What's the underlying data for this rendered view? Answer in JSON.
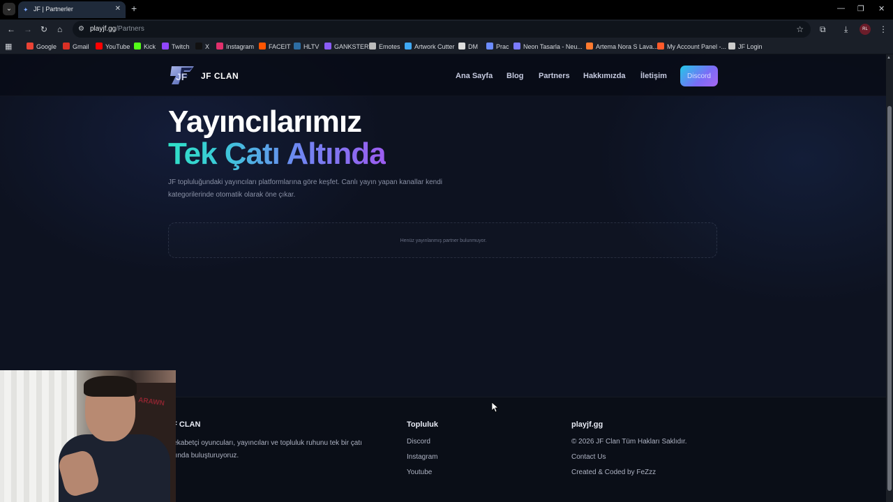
{
  "browser": {
    "tab_title": "JF | Partnerler",
    "url_host": "playjf.gg",
    "url_path": "/Partners",
    "profile_initials": "RL",
    "bookmarks": [
      {
        "label": "Google",
        "icon_color": "#ea4335"
      },
      {
        "label": "Gmail",
        "icon_color": "#d93025"
      },
      {
        "label": "YouTube",
        "icon_color": "#ff0000"
      },
      {
        "label": "Kick",
        "icon_color": "#53fc18"
      },
      {
        "label": "Twitch",
        "icon_color": "#9146ff"
      },
      {
        "label": "X",
        "icon_color": "#111111"
      },
      {
        "label": "Instagram",
        "icon_color": "#e1306c"
      },
      {
        "label": "FACEIT",
        "icon_color": "#ff5500"
      },
      {
        "label": "HLTV",
        "icon_color": "#2d6da3"
      },
      {
        "label": "GANKSTER",
        "icon_color": "#8a5cf6"
      },
      {
        "label": "Emotes",
        "icon_color": "#bbbbbb"
      },
      {
        "label": "Artwork Cutter",
        "icon_color": "#3fa9f5"
      },
      {
        "label": "DM",
        "icon_color": "#dddddd"
      },
      {
        "label": "Prac",
        "icon_color": "#6c8cff"
      },
      {
        "label": "Neon Tasarla - Neu...",
        "icon_color": "#7b7bff"
      },
      {
        "label": "Artema Nora S Lava...",
        "icon_color": "#ff7a2f"
      },
      {
        "label": "My Account Panel -...",
        "icon_color": "#ff5a2a"
      },
      {
        "label": "JF Login",
        "icon_color": "#cccccc"
      }
    ]
  },
  "nav": {
    "brand": "JF CLAN",
    "links": [
      "Ana Sayfa",
      "Blog",
      "Partners",
      "Hakkımızda",
      "İletişim"
    ],
    "cta": "Discord"
  },
  "hero": {
    "line1": "Yayıncılarımız",
    "line2": "Tek Çatı Altında",
    "description": "JF topluluğundaki yayıncıları platformlarına göre keşfet. Canlı yayın yapan kanallar kendi kategorilerinde otomatik olarak öne çıkar."
  },
  "partners": {
    "empty_message": "Henüz yayınlanmış partner bulunmuyor."
  },
  "footer": {
    "brand_title": "JF CLAN",
    "brand_line1": "Rekabetçi oyuncuları, yayıncıları ve topluluk ruhunu tek bir çatı",
    "brand_line2": "altında buluşturuyoruz.",
    "community_title": "Topluluk",
    "community_links": [
      "Discord",
      "Instagram",
      "Youtube"
    ],
    "site_title": "playjf.gg",
    "site_lines": [
      "© 2026 JF Clan Tüm Hakları Saklıdır.",
      "Contact Us",
      "Created & Coded by FeZzz"
    ]
  },
  "webcam": {
    "chair_text": "ARAWN"
  },
  "colors": {
    "accent_start": "#22c8e8",
    "accent_end": "#a766f0",
    "page_bg": "#0d1220"
  }
}
